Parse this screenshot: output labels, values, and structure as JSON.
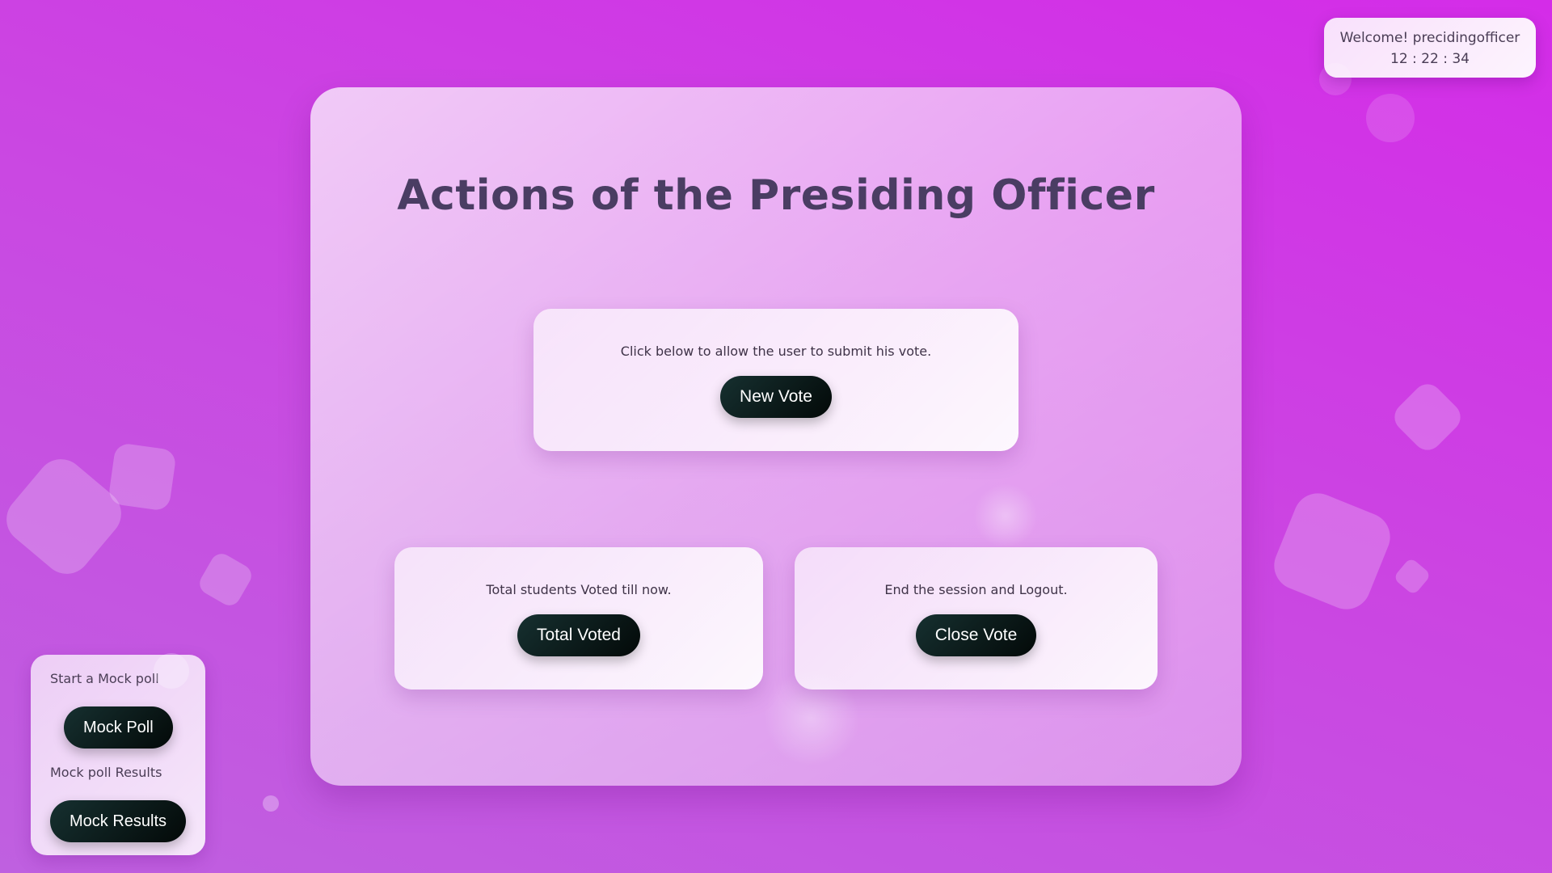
{
  "header": {
    "welcome_text": "Welcome! precidingofficer",
    "clock": "12 : 22 : 34"
  },
  "main": {
    "title": "Actions of the Presiding Officer",
    "new_vote": {
      "description": "Click below to allow the user to submit his vote.",
      "button_label": "New Vote"
    },
    "total_voted": {
      "description": "Total students Voted till now.",
      "button_label": "Total Voted"
    },
    "close_vote": {
      "description": "End the session and Logout.",
      "button_label": "Close Vote"
    }
  },
  "mock": {
    "start_label": "Start a Mock poll",
    "poll_button_label": "Mock Poll",
    "results_label": "Mock poll Results",
    "results_button_label": "Mock Results"
  }
}
